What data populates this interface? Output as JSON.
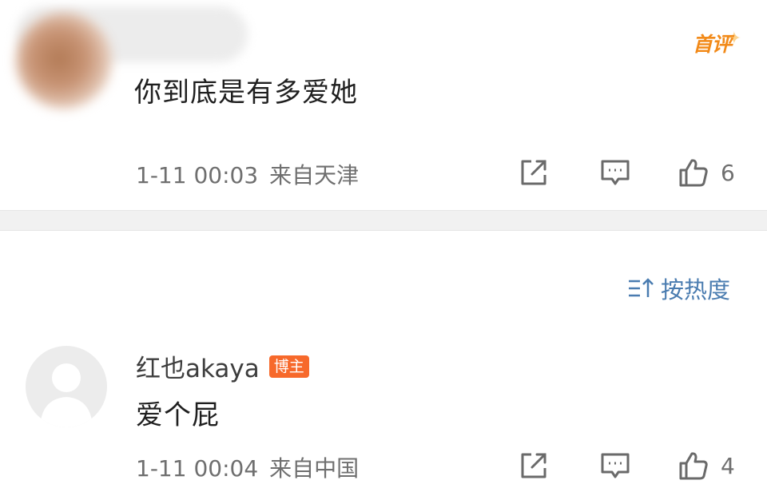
{
  "comments": [
    {
      "text": "你到底是有多爱她",
      "time": "1-11 00:03",
      "location": "来自天津",
      "likes": "6",
      "badge": "首评"
    },
    {
      "author": "红也akaya",
      "author_badge": "博主",
      "text": "爱个屁",
      "time": "1-11 00:04",
      "location": "来自中国",
      "likes": "4"
    }
  ],
  "sort": {
    "label": "按热度"
  },
  "colors": {
    "accent_blue": "#4a7cb0",
    "badge_orange": "#f7692b",
    "first_badge_orange": "#f28a19",
    "meta_gray": "#6f6f6f"
  },
  "icons": {
    "share": "share-icon",
    "comment": "comment-icon",
    "like": "like-icon",
    "sort": "sort-icon"
  }
}
